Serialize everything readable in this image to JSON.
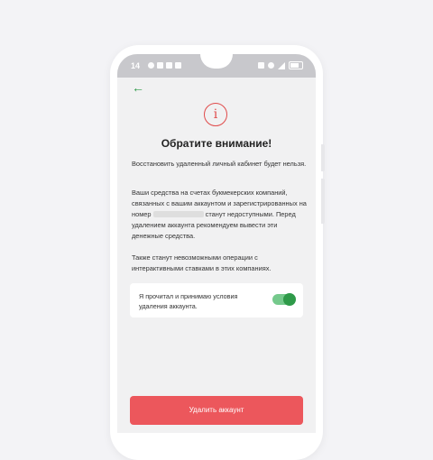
{
  "statusbar": {
    "time": "14"
  },
  "header": {
    "back_icon": "arrow-left-icon",
    "accent_color": "#2e9a49"
  },
  "alert": {
    "icon": "info-circle-icon",
    "icon_glyph": "i",
    "icon_color": "#e04b4b",
    "title": "Обратите внимание!",
    "paragraph1": "Восстановить удаленный личный кабинет будет нельзя.",
    "paragraph2_before": "Ваши средства на счетах букмекерских компаний, связанных с вашим аккаунтом и зарегистрированных на номер",
    "paragraph2_after": "станут недоступными. Перед удалением аккаунта рекомендуем вывести эти денежные средства.",
    "paragraph3": "Также станут невозможными операции с интерактивными ставками в этих компаниях."
  },
  "consent": {
    "label": "Я прочитал и принимаю условия удаления аккаунта.",
    "toggle_on": true
  },
  "delete_button": {
    "label": "Удалить аккаунт",
    "color": "#ec575c"
  }
}
